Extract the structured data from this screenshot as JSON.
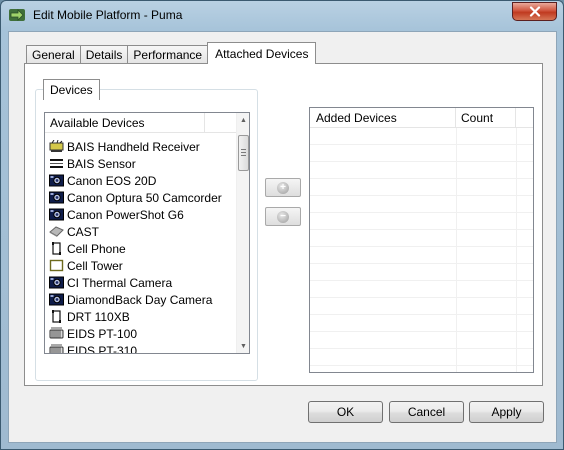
{
  "window": {
    "title": "Edit Mobile Platform - Puma"
  },
  "tabs": [
    {
      "label": "General"
    },
    {
      "label": "Details"
    },
    {
      "label": "Performance"
    },
    {
      "label": "Attached Devices",
      "active": true
    }
  ],
  "devices_group": {
    "label": "Devices",
    "list_header": "Available Devices",
    "items": [
      {
        "label": "BAIS Handheld Receiver",
        "icon": "receiver-icon"
      },
      {
        "label": "BAIS Sensor",
        "icon": "sensor-icon"
      },
      {
        "label": "Canon EOS 20D",
        "icon": "camera-icon"
      },
      {
        "label": "Canon Optura 50 Camcorder",
        "icon": "camera-icon"
      },
      {
        "label": "Canon PowerShot G6",
        "icon": "camera-icon"
      },
      {
        "label": "CAST",
        "icon": "cast-icon"
      },
      {
        "label": "Cell Phone",
        "icon": "phone-icon"
      },
      {
        "label": "Cell Tower",
        "icon": "tower-icon"
      },
      {
        "label": "CI Thermal Camera",
        "icon": "camera-icon"
      },
      {
        "label": "DiamondBack Day Camera",
        "icon": "camera-icon"
      },
      {
        "label": "DRT 110XB",
        "icon": "phone-icon"
      },
      {
        "label": "EIDS PT-100",
        "icon": "eids-icon"
      },
      {
        "label": "EIDS PT-310",
        "icon": "eids-icon"
      }
    ]
  },
  "added_devices": {
    "columns": [
      "Added Devices",
      "Count"
    ],
    "rows": []
  },
  "buttons": {
    "add": "+",
    "remove": "−",
    "ok": "OK",
    "cancel": "Cancel",
    "apply": "Apply"
  },
  "colors": {
    "title_bar": "#a6c3d9",
    "close_button": "#c03a20",
    "panel_bg": "#f0f0f0"
  }
}
